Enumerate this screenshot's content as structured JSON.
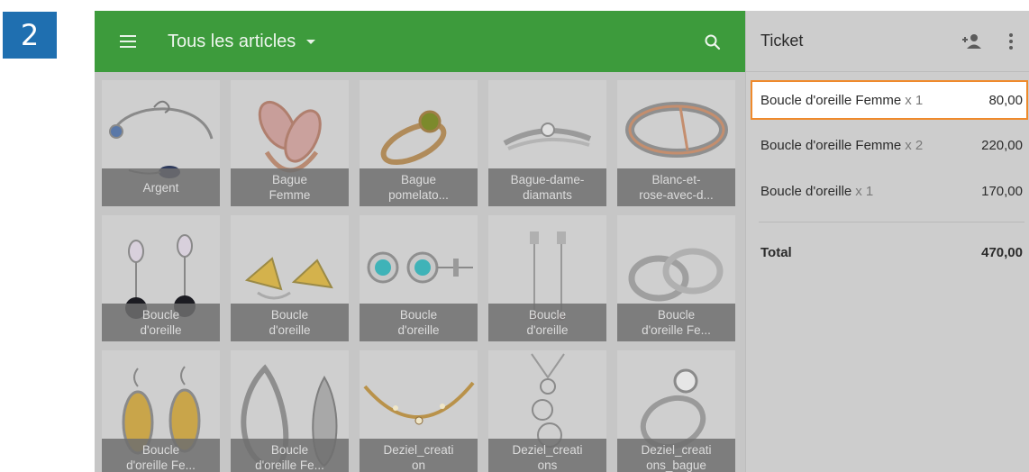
{
  "step_badge": "2",
  "toolbar": {
    "title": "Tous les articles",
    "icons": [
      "menu-icon",
      "dropdown-caret-icon",
      "search-icon"
    ]
  },
  "items": [
    {
      "label": "Argent"
    },
    {
      "label": "Bague\nFemme"
    },
    {
      "label": "Bague\npomelato..."
    },
    {
      "label": "Bague-dame-\ndiamants"
    },
    {
      "label": "Blanc-et-\nrose-avec-d..."
    },
    {
      "label": "Boucle\nd'oreille"
    },
    {
      "label": "Boucle\nd'oreille"
    },
    {
      "label": "Boucle\nd'oreille"
    },
    {
      "label": "Boucle\nd'oreille"
    },
    {
      "label": "Boucle\nd'oreille Fe..."
    },
    {
      "label": "Boucle\nd'oreille Fe..."
    },
    {
      "label": "Boucle\nd'oreille Fe..."
    },
    {
      "label": "Deziel_creati\non"
    },
    {
      "label": "Deziel_creati\nons"
    },
    {
      "label": "Deziel_creati\nons_bague"
    }
  ],
  "ticket": {
    "title": "Ticket",
    "icons": [
      "add-customer-icon",
      "more-vert-icon"
    ],
    "lines": [
      {
        "name": "Boucle d'oreille Femme",
        "qty": "x 1",
        "price": "80,00",
        "selected": true
      },
      {
        "name": "Boucle d'oreille Femme",
        "qty": "x 2",
        "price": "220,00",
        "selected": false
      },
      {
        "name": "Boucle d'oreille",
        "qty": "x 1",
        "price": "170,00",
        "selected": false
      }
    ],
    "total_label": "Total",
    "total_value": "470,00"
  },
  "colors": {
    "toolbar_green": "#3d9b3c",
    "badge_blue": "#1f6fb0",
    "selection_orange": "#ef8a2c"
  }
}
